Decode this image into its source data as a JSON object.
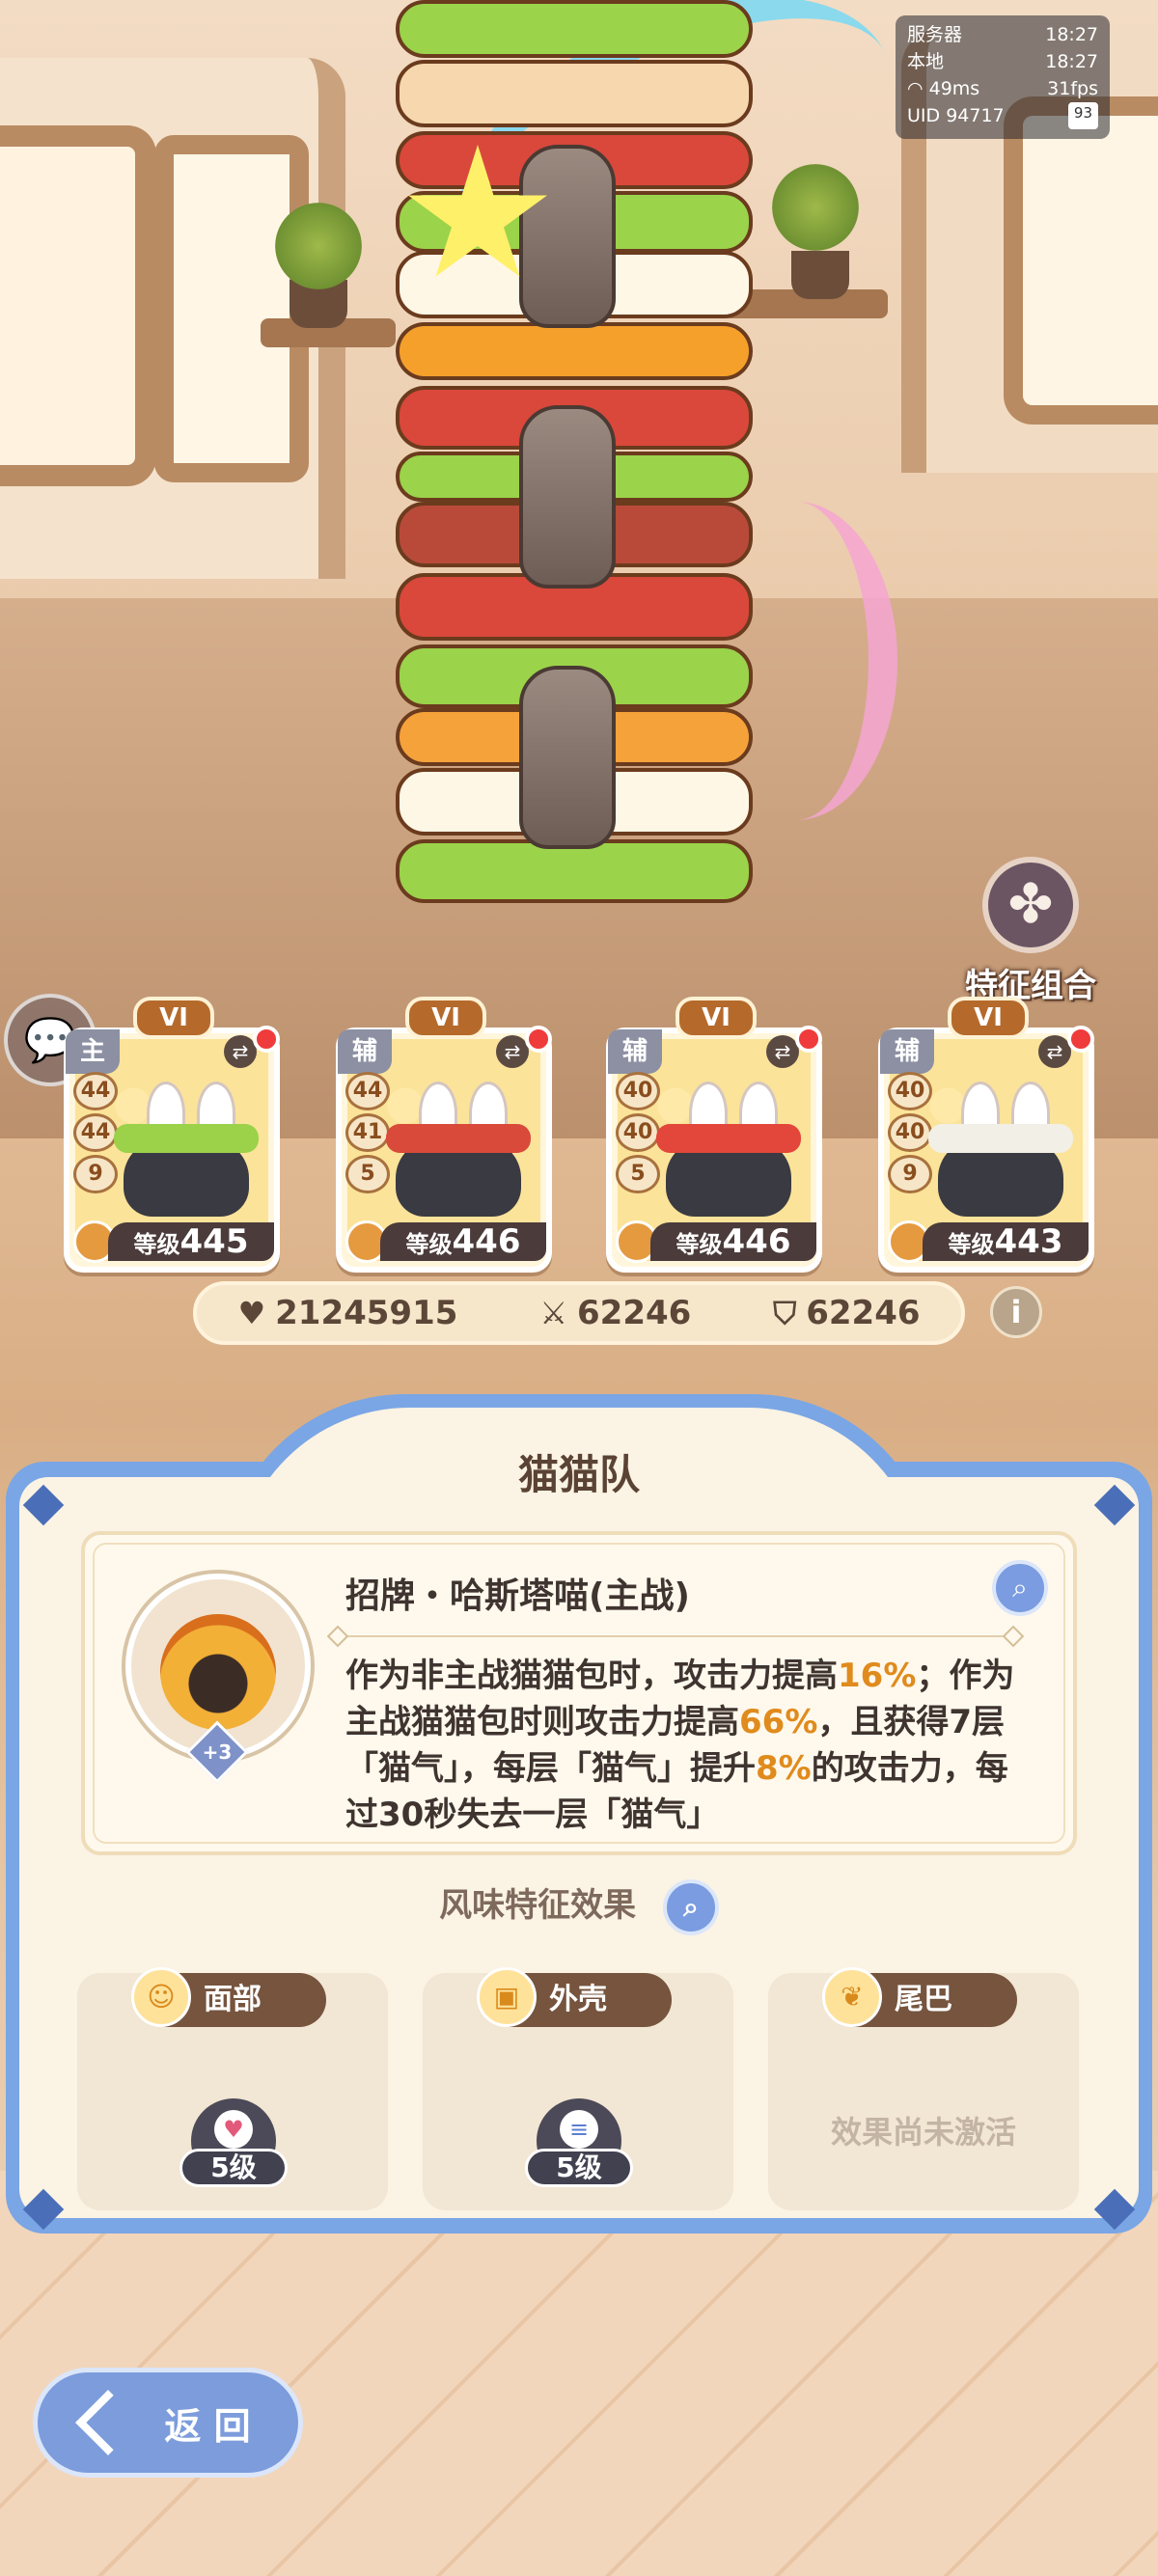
{
  "status": {
    "server_label": "服务器",
    "server_time": "18:27",
    "local_label": "本地",
    "local_time": "18:27",
    "ping": "49ms",
    "fps": "31fps",
    "uid_label": "UID",
    "uid": "94717",
    "battery": "93"
  },
  "trait_combo": {
    "label": "特征组合",
    "icon": "clover-icon"
  },
  "chat": {
    "icon": "chat-bubble-icon"
  },
  "cards": [
    {
      "rank": "VI",
      "role": "主",
      "stats": [
        "44",
        "44",
        "9"
      ],
      "level_label": "等级",
      "level": "445",
      "filling_color": "#9cd14a"
    },
    {
      "rank": "VI",
      "role": "辅",
      "stats": [
        "44",
        "41",
        "5"
      ],
      "level_label": "等级",
      "level": "446",
      "filling_color": "#d94a3a"
    },
    {
      "rank": "VI",
      "role": "辅",
      "stats": [
        "40",
        "40",
        "5"
      ],
      "level_label": "等级",
      "level": "446",
      "filling_color": "#e3463a"
    },
    {
      "rank": "VI",
      "role": "辅",
      "stats": [
        "40",
        "40",
        "9"
      ],
      "level_label": "等级",
      "level": "443",
      "filling_color": "#f2efe6"
    }
  ],
  "summary": {
    "hp": "21245915",
    "attack": "62246",
    "defense": "62246"
  },
  "panel": {
    "title": "猫猫队",
    "skill_name": "招牌・哈斯塔喵(主战)",
    "avatar_bonus": "+3",
    "desc": [
      {
        "text": "作为非主战猫猫包时，攻击力提高",
        "hl": false
      },
      {
        "text": "16%",
        "hl": true
      },
      {
        "text": "；作为主战猫猫包时则攻击力提高",
        "hl": false
      },
      {
        "text": "66%",
        "hl": true
      },
      {
        "text": "，且获得7层「猫气」，每层「猫气」提升",
        "hl": false
      },
      {
        "text": "8%",
        "hl": true
      },
      {
        "text": "的攻击力，每过30秒失去一层「猫气」",
        "hl": false
      }
    ],
    "flavor_title": "风味特征效果",
    "traits": [
      {
        "tab": "面部",
        "level": "5级",
        "active": true
      },
      {
        "tab": "外壳",
        "level": "5级",
        "active": true
      },
      {
        "tab": "尾巴",
        "inactive_text": "效果尚未激活",
        "active": false
      }
    ]
  },
  "back": {
    "label": "返 回"
  },
  "colors": {
    "accent_blue": "#7aa6e5",
    "highlight": "#e08b1d",
    "text_dark": "#3f3430"
  }
}
